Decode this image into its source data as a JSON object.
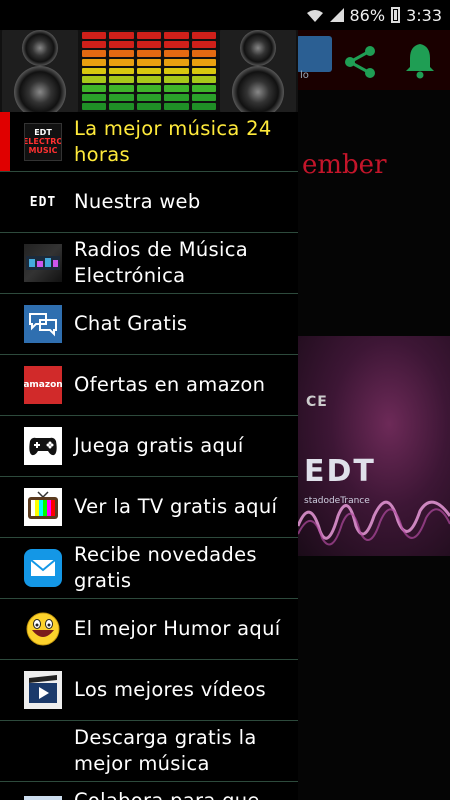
{
  "status_bar": {
    "battery_percent": "86%",
    "time": "3:33"
  },
  "background_app": {
    "toolbar_tile_label": "lo",
    "red_text": "ember",
    "image_top_text": "CE",
    "image_logo_text": "EDT",
    "image_sub_text": "stadodeTrance",
    "accent_red": "#c4152a"
  },
  "drawer": {
    "header_image": "speakers-equalizer",
    "items": [
      {
        "label": "La mejor música 24 horas",
        "icon": "electro-music-icon",
        "active": true,
        "icon_text_1": "EDT",
        "icon_text_2": "ELECTRO",
        "icon_text_3": "MUSIC"
      },
      {
        "label": "Nuestra web",
        "icon": "edt-logo-icon",
        "icon_text": "EDT"
      },
      {
        "label": "Radios de Música Electrónica",
        "icon": "radio-icon"
      },
      {
        "label": "Chat Gratis",
        "icon": "chat-icon"
      },
      {
        "label": "Ofertas en amazon",
        "icon": "amazon-icon",
        "icon_text": "amazon"
      },
      {
        "label": "Juega gratis aquí",
        "icon": "gamepad-icon"
      },
      {
        "label": "Ver la TV gratis aquí",
        "icon": "tv-icon"
      },
      {
        "label": "Recibe novedades gratis",
        "icon": "mail-icon"
      },
      {
        "label": "El mejor Humor aquí",
        "icon": "smiley-icon"
      },
      {
        "label": "Los mejores vídeos",
        "icon": "video-icon"
      },
      {
        "label": "Descarga gratis la mejor música",
        "icon": "none"
      },
      {
        "label": "Colabora para que",
        "icon": "partial-icon"
      }
    ],
    "active_color": "#ffea3b",
    "active_bar_color": "#e00000"
  }
}
